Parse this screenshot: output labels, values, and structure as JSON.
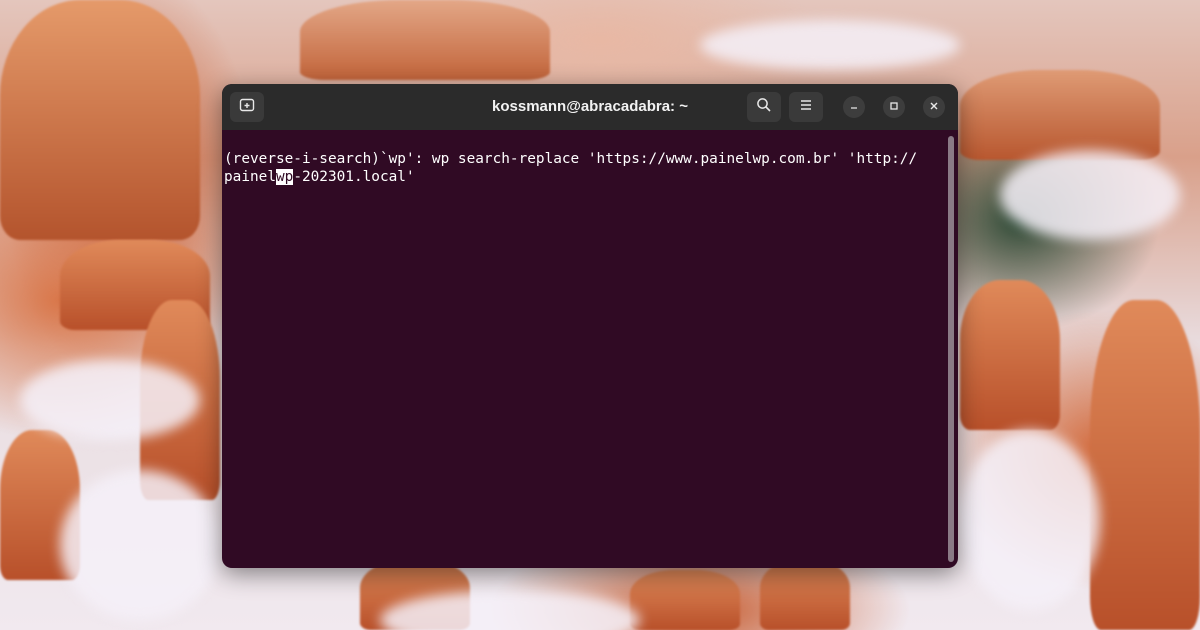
{
  "window": {
    "title": "kossmann@abracadabra: ~"
  },
  "titlebar": {
    "new_tab_icon": "new-tab-icon",
    "search_icon": "search-icon",
    "menu_icon": "hamburger-menu-icon",
    "minimize_icon": "minimize-icon",
    "maximize_icon": "maximize-icon",
    "close_icon": "close-icon"
  },
  "terminal": {
    "line1": "(reverse-i-search)`wp': wp search-replace 'https://www.painelwp.com.br' 'http://",
    "line2_before": "painel",
    "line2_highlight": "wp",
    "line2_after": "-202301.local'",
    "background_color": "#300a24",
    "text_color": "#ffffff"
  }
}
